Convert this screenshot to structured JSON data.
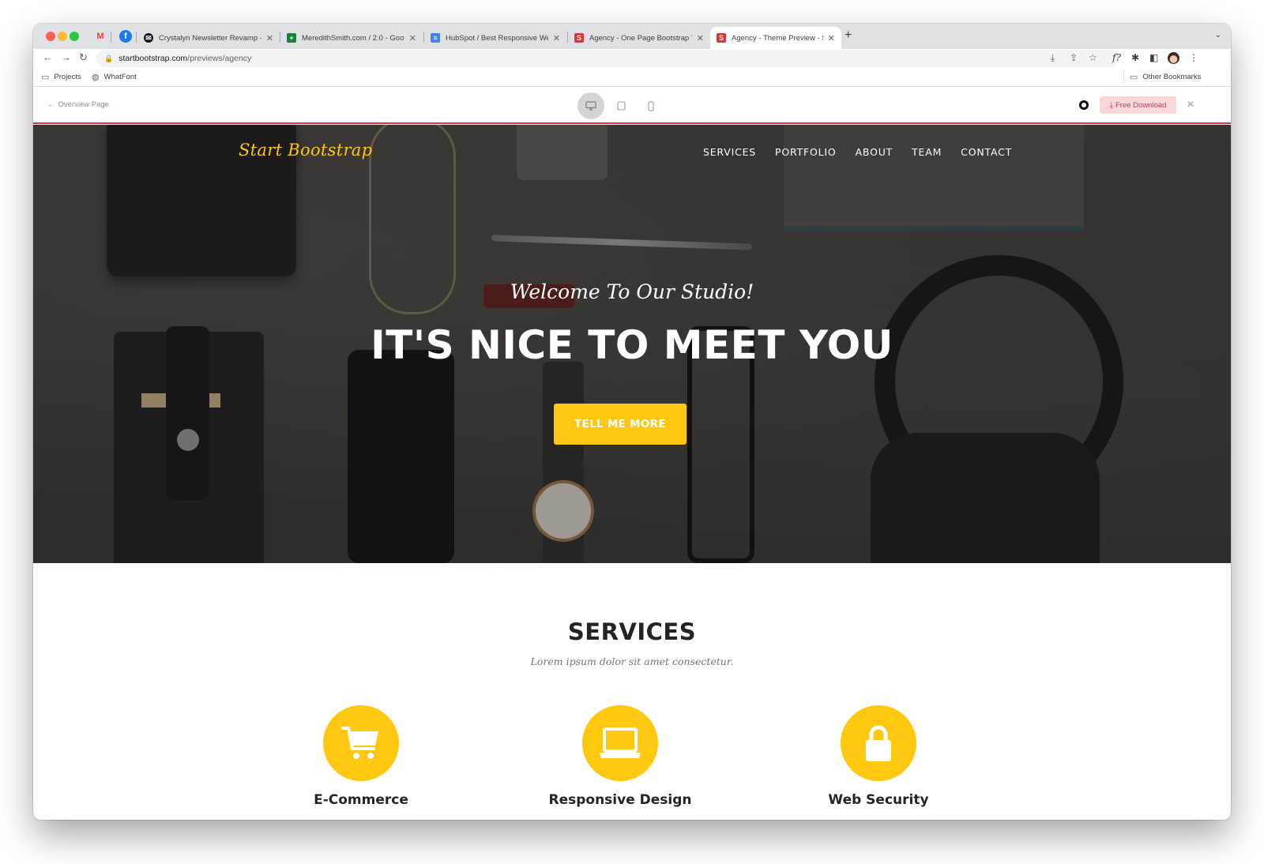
{
  "browser": {
    "pinned_tabs": [
      {
        "name": "gmail",
        "glyph": "M"
      },
      {
        "name": "facebook",
        "glyph": "f"
      }
    ],
    "tabs": [
      {
        "title": "Crystalyn Newsletter Revamp -",
        "favicon": "mailchimp-icon",
        "favicon_color": "#111111",
        "active": false
      },
      {
        "title": "MeredithSmith.com / 2.0 - Goo",
        "favicon": "sheets-icon",
        "favicon_color": "#188038",
        "active": false
      },
      {
        "title": "HubSpot / Best Responsive We",
        "favicon": "docs-icon",
        "favicon_color": "#4285f4",
        "active": false
      },
      {
        "title": "Agency - One Page Bootstrap T",
        "favicon": "startbootstrap-icon",
        "favicon_color": "#dd3333",
        "active": false
      },
      {
        "title": "Agency - Theme Preview - Star",
        "favicon": "startbootstrap-icon",
        "favicon_color": "#dd3333",
        "active": true
      }
    ],
    "close_glyph": "✕",
    "new_tab_glyph": "+",
    "url_domain": "startbootstrap.com",
    "url_path": "/previews/agency",
    "bookmarks": [
      {
        "label": "Projects",
        "icon": "folder-icon"
      },
      {
        "label": "WhatFont",
        "icon": "globe-icon"
      }
    ],
    "other_bookmarks": "Other Bookmarks"
  },
  "preview_bar": {
    "back_label": "Overview Page",
    "devices": [
      {
        "name": "desktop",
        "active": true
      },
      {
        "name": "tablet",
        "active": false
      },
      {
        "name": "mobile",
        "active": false
      }
    ],
    "download_label": "Free Download",
    "accent": "#dc3545"
  },
  "site": {
    "brand": "Start Bootstrap",
    "nav": [
      "SERVICES",
      "PORTFOLIO",
      "ABOUT",
      "TEAM",
      "CONTACT"
    ],
    "hero": {
      "subheading": "Welcome To Our Studio!",
      "heading": "IT'S NICE TO MEET YOU",
      "cta": "TELL ME MORE"
    },
    "services": {
      "title": "SERVICES",
      "subtitle": "Lorem ipsum dolor sit amet consectetur.",
      "items": [
        {
          "name": "E-Commerce",
          "icon": "shopping-cart-icon"
        },
        {
          "name": "Responsive Design",
          "icon": "laptop-icon"
        },
        {
          "name": "Web Security",
          "icon": "lock-icon"
        }
      ]
    },
    "colors": {
      "primary": "#fec810",
      "heading": "#212529",
      "muted": "#6c757d"
    }
  }
}
